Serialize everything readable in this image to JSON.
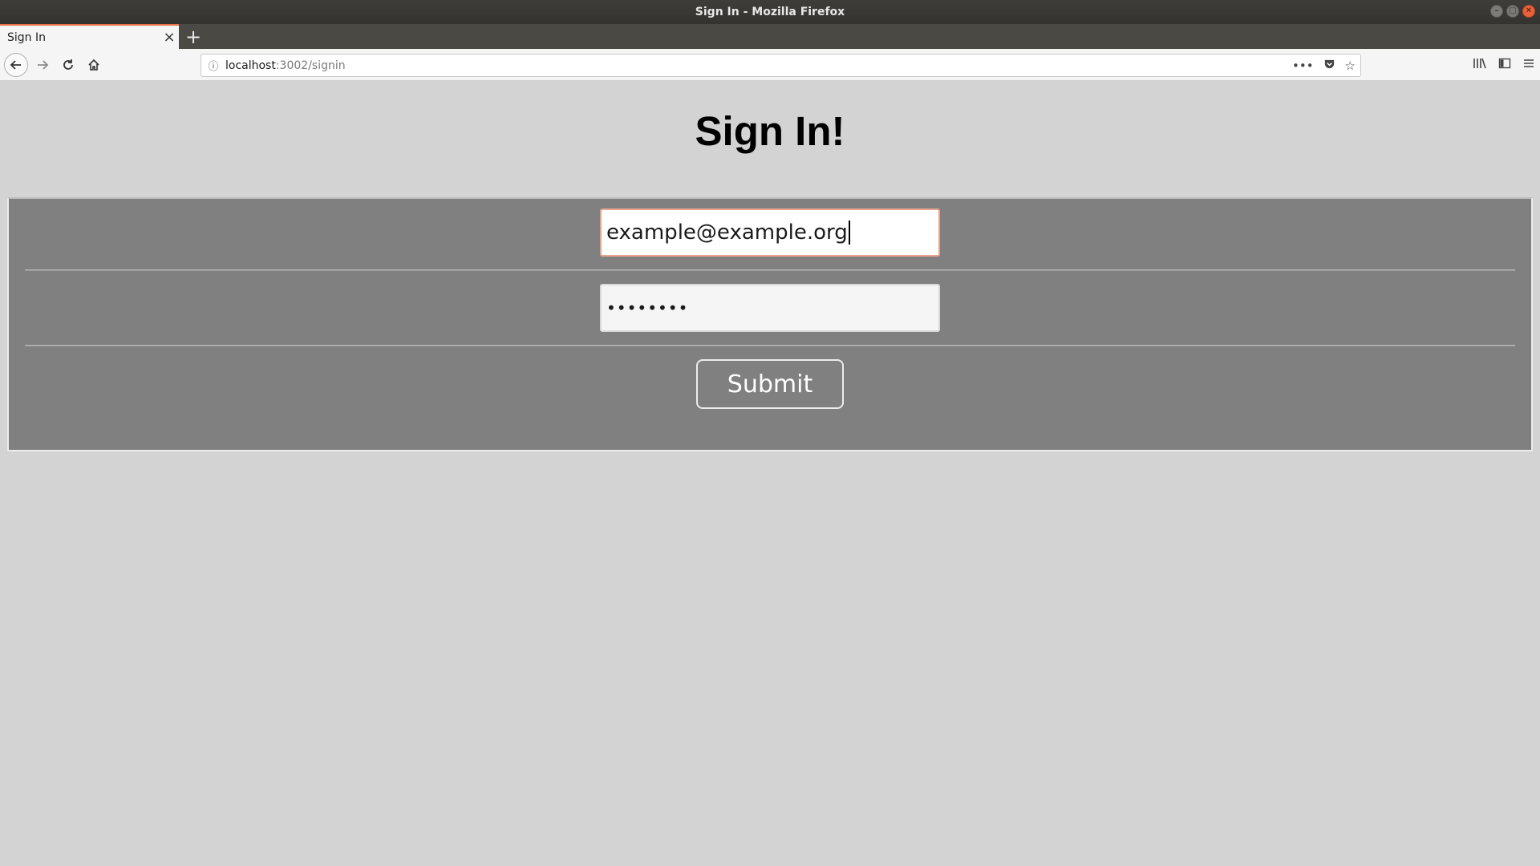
{
  "window": {
    "title": "Sign In - Mozilla Firefox"
  },
  "tabs": [
    {
      "label": "Sign In",
      "active": true
    }
  ],
  "navbar": {
    "url_host": "localhost",
    "url_path": ":3002/signin"
  },
  "page": {
    "heading": "Sign In!",
    "email_value": "example@example.org",
    "password_mask": "••••••••",
    "submit_label": "Submit"
  },
  "colors": {
    "page_background": "#d3d3d3",
    "form_background": "#808080",
    "tab_accent": "#e8744a",
    "focus_border": "#e9a48f"
  },
  "icons": {
    "back": "back-arrow-icon",
    "forward": "forward-arrow-icon",
    "reload": "reload-icon",
    "home": "home-icon",
    "site_info": "info-icon",
    "page_actions": "more-dots-icon",
    "pocket": "pocket-icon",
    "bookmark": "star-icon",
    "library": "library-icon",
    "sidebar": "sidebar-icon",
    "menu": "hamburger-menu-icon"
  }
}
